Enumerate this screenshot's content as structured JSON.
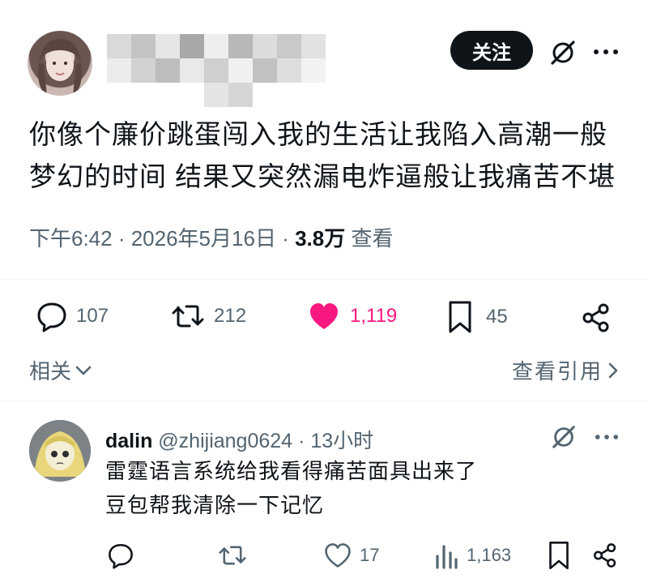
{
  "post": {
    "follow_label": "关注",
    "text": "你像个廉价跳蛋闯入我的生活让我陷入高潮一般梦幻的时间 结果又突然漏电炸逼般让我痛苦不堪",
    "time": "下午6:42",
    "date": "2026年5月16日",
    "views_count": "3.8万",
    "views_label": "查看",
    "actions": {
      "replies": "107",
      "reposts": "212",
      "likes": "1,119",
      "bookmarks": "45"
    },
    "like_color": "#f91880",
    "related_label": "相关",
    "view_quotes_label": "查看引用"
  },
  "reply": {
    "name": "dalin",
    "handle": "@zhijiang0624",
    "time": "13小时",
    "lines": [
      "雷霆语言系统给我看得痛苦面具出来了",
      "豆包帮我清除一下记忆"
    ],
    "actions": {
      "replies": "",
      "reposts": "",
      "likes": "17",
      "views": "1,163"
    }
  },
  "icons": [
    "grok-icon",
    "more-icon",
    "reply-icon",
    "repost-icon",
    "heart-icon",
    "bookmark-icon",
    "share-icon",
    "chevron-down-icon",
    "chevron-right-icon",
    "views-icon"
  ]
}
